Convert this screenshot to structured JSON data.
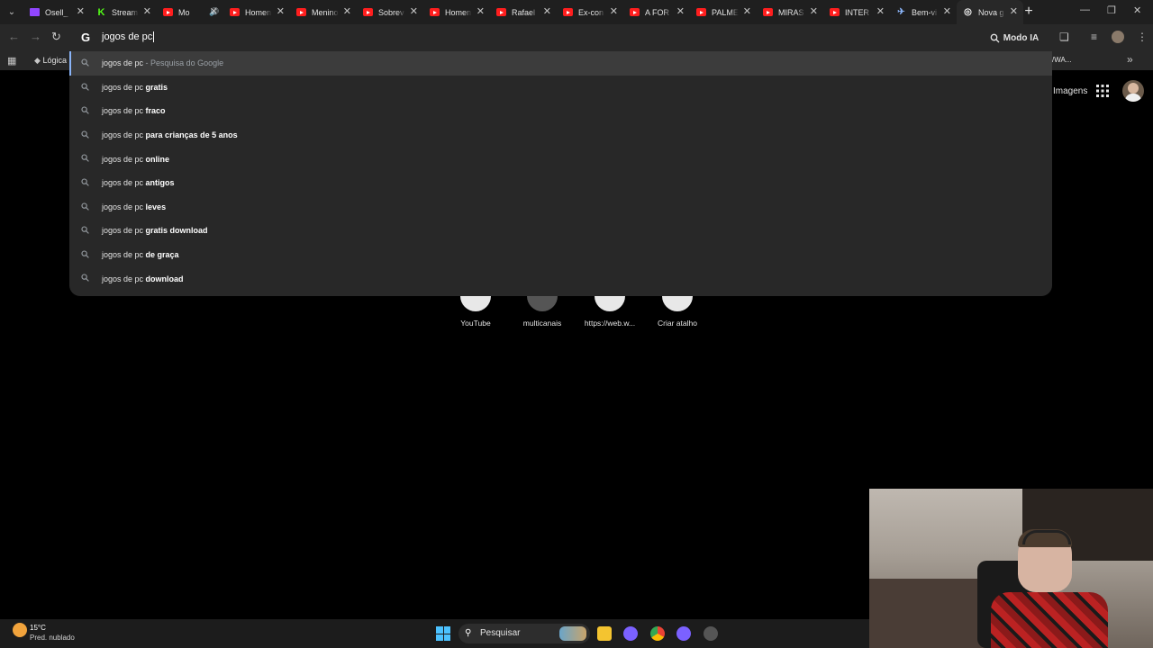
{
  "tabs": [
    {
      "title": "Osell_",
      "icon": "twitch-icon",
      "fav": "twitch"
    },
    {
      "title": "Stream",
      "icon": "kick-icon",
      "fav": "kick"
    },
    {
      "title": "Mo",
      "icon": "youtube-icon",
      "fav": "yt",
      "audio": true
    },
    {
      "title": "Homen",
      "icon": "youtube-icon",
      "fav": "yt"
    },
    {
      "title": "Menino",
      "icon": "youtube-icon",
      "fav": "yt"
    },
    {
      "title": "Sobrev",
      "icon": "youtube-icon",
      "fav": "yt"
    },
    {
      "title": "Homen",
      "icon": "youtube-icon",
      "fav": "yt"
    },
    {
      "title": "Rafael",
      "icon": "youtube-icon",
      "fav": "yt"
    },
    {
      "title": "Ex-con",
      "icon": "youtube-icon",
      "fav": "yt"
    },
    {
      "title": "A FOR",
      "icon": "youtube-icon",
      "fav": "yt"
    },
    {
      "title": "PALME",
      "icon": "youtube-icon",
      "fav": "yt"
    },
    {
      "title": "MIRAS",
      "icon": "youtube-icon",
      "fav": "yt"
    },
    {
      "title": "INTER",
      "icon": "youtube-icon",
      "fav": "yt"
    },
    {
      "title": "Bem-vi",
      "icon": "steam-icon",
      "fav": "edge"
    },
    {
      "title": "Nova g",
      "icon": "google-icon",
      "fav": "g",
      "active": true
    }
  ],
  "omnibox": {
    "query": "jogos de pc",
    "modo_ia": "Modo IA"
  },
  "bookmarks": {
    "first": "Lógica",
    "right": "/WA..."
  },
  "suggestions": [
    {
      "prefix": "jogos de pc",
      "bold": "",
      "hint": " - Pesquisa do Google"
    },
    {
      "prefix": "jogos de pc ",
      "bold": "gratis",
      "hint": ""
    },
    {
      "prefix": "jogos de pc ",
      "bold": "fraco",
      "hint": ""
    },
    {
      "prefix": "jogos de pc ",
      "bold": "para crianças de 5 anos",
      "hint": ""
    },
    {
      "prefix": "jogos de pc ",
      "bold": "online",
      "hint": ""
    },
    {
      "prefix": "jogos de pc ",
      "bold": "antigos",
      "hint": ""
    },
    {
      "prefix": "jogos de pc ",
      "bold": "leves",
      "hint": ""
    },
    {
      "prefix": "jogos de pc ",
      "bold": "gratis download",
      "hint": ""
    },
    {
      "prefix": "jogos de pc ",
      "bold": "de graça",
      "hint": ""
    },
    {
      "prefix": "jogos de pc ",
      "bold": "download",
      "hint": ""
    }
  ],
  "page": {
    "imagens": "Imagens"
  },
  "shortcuts": [
    {
      "label": "YouTube"
    },
    {
      "label": "multicanais"
    },
    {
      "label": "https://web.w..."
    },
    {
      "label": "Criar atalho"
    }
  ],
  "taskbar": {
    "temp": "15°C",
    "weather": "Pred. nublado",
    "search": "Pesquisar"
  },
  "colors": {
    "accent": "#8ab4f8",
    "youtube": "#ff1e1e",
    "twitch": "#9146ff",
    "windows": "#4cc2ff"
  }
}
